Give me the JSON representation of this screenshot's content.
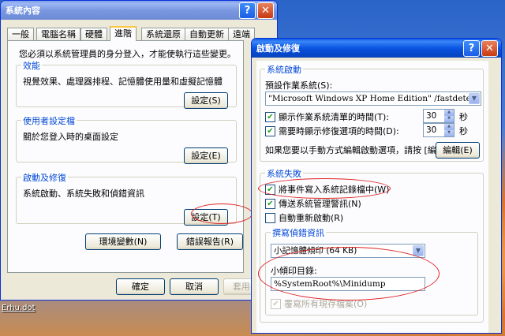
{
  "desktop": {
    "icon_label": "Erhu.dot"
  },
  "sysprop": {
    "title": "系統內容",
    "tabs": [
      "一般",
      "電腦名稱",
      "硬體",
      "進階",
      "系統還原",
      "自動更新",
      "遠端"
    ],
    "active_tab": "進階",
    "intro": "您必須以系統管理員的身分登入，才能使執行這些變更。",
    "performance": {
      "title": "效能",
      "desc": "視覺效果、處理器排程、記憶體使用量和虛擬記憶體",
      "button": "設定(S)"
    },
    "profiles": {
      "title": "使用者設定檔",
      "desc": "關於您登入時的桌面設定",
      "button": "設定(E)"
    },
    "startup": {
      "title": "啟動及修復",
      "desc": "系統啟動、系統失敗和偵錯資訊",
      "button": "設定(T)"
    },
    "env_button": "環境變數(N)",
    "error_button": "錯誤報告(R)",
    "ok": "確定",
    "cancel": "取消",
    "apply": "套用(A)"
  },
  "startup_dlg": {
    "title": "啟動及修復",
    "system_startup": {
      "title": "系統啟動",
      "default_os_label": "預設作業系統(S):",
      "default_os_value": "\"Microsoft Windows XP Home Edition\" /fastdetect /NoExecute=Op",
      "show_os_list_label": "顯示作業系統清單的時間(T):",
      "show_os_list_value": "30",
      "show_recovery_label": "需要時顯示修復選項的時間(D):",
      "show_recovery_value": "30",
      "seconds": "秒",
      "edit_text": "如果您要以手動方式編輯啟動選項，請按 [編輯]。",
      "edit_button": "編輯(E)"
    },
    "system_failure": {
      "title": "系統失敗",
      "write_event_label": "將事件寫入系統記錄檔中(W)",
      "send_alert_label": "傳送系統管理警訊(N)",
      "auto_restart_label": "自動重新啟動(R)"
    },
    "debug_info": {
      "title": "撰寫偵錯資訊",
      "dump_type": "小記憶體傾印 (64 KB)",
      "dump_dir_label": "小傾印目錄:",
      "dump_dir_value": "%SystemRoot%\\Minidump",
      "overwrite_label": "覆寫所有現存檔案(O)"
    },
    "ok": "確定",
    "cancel": "取消"
  },
  "colors": {
    "titlebar": "#0a55e2",
    "annotation": "#e02020",
    "group_title": "#0046d5"
  }
}
